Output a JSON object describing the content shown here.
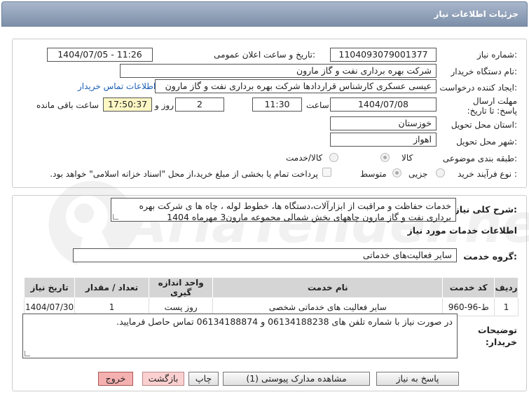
{
  "window": {
    "title": "جزئیات اطلاعات نیاز"
  },
  "watermark": {
    "text": "AriaTender.net"
  },
  "info": {
    "need_number_label": "شماره نیاز:",
    "need_number": "1104093079001377",
    "announce_label": "تاریخ و ساعت اعلان عمومی:",
    "announce_value": "1404/07/05 - 11:26",
    "buyer_label": "نام دستگاه خریدار:",
    "buyer": "شرکت بهره برداری نفت و گاز مارون",
    "creator_label": "ایجاد کننده درخواست:",
    "creator": "عیسی عسکری کارشناس قراردادها شرکت بهره برداری نفت و گاز مارون",
    "contact_link": "اطلاعات تماس خریدار",
    "deadline_label": "مهلت ارسال پاسخ: تا تاریخ:",
    "deadline_date": "1404/07/08",
    "time_label": "ساعت",
    "deadline_time": "11:30",
    "days": "2",
    "days_label": "روز و",
    "remaining": "17:50:37",
    "remaining_label": "ساعت باقی مانده",
    "province_label": "استان محل تحویل:",
    "province": "خوزستان",
    "city_label": "شهر محل تحویل:",
    "city": "اهواز",
    "category_label": "طبقه بندی موضوعی:",
    "category_options": [
      "کالا",
      "کالا/خدمت"
    ],
    "process_label": "نوع فرآیند خرید :",
    "process_options": [
      "جزیی",
      "متوسط"
    ],
    "payment_note": "پرداخت تمام یا بخشی از مبلغ خرید،از محل \"اسناد خزانه اسلامی\" خواهد بود."
  },
  "details": {
    "summary_label": "شرح کلی نیاز:",
    "summary": "خدمات حفاظت و مراقبت از ابزارآلات،دستگاه ها، خطوط لوله ، چاه ها ی شرکت بهره برداری نفت و گاز مارون چاههای بخش شمالی مجموعه مارون3 مهرماه 1404",
    "services_heading": "اطلاعات خدمات مورد نیاز",
    "service_group_label": "گروه خدمت:",
    "service_group": "سایر فعالیت‌های خدماتی",
    "table": {
      "headers": [
        "ردیف",
        "کد خدمت",
        "نام خدمت",
        "واحد اندازه گیری",
        "تعداد / مقدار",
        "تاریخ نیاز"
      ],
      "rows": [
        [
          "1",
          "ط-96-960",
          "سایر فعالیت های خدماتی شخصی",
          "روز پست",
          "1",
          "1404/07/30"
        ]
      ]
    },
    "buyer_notes_label": "توضیحات خریدار:",
    "buyer_notes": "در صورت نیاز با شماره تلفن های 06134188238 و 06134188874 تماس حاصل فرمایید."
  },
  "buttons": {
    "reply": "پاسخ به نیاز",
    "attachments": "مشاهده مدارک پیوستی (1)",
    "print": "چاپ",
    "back": "بازگشت",
    "exit": "خروج"
  }
}
